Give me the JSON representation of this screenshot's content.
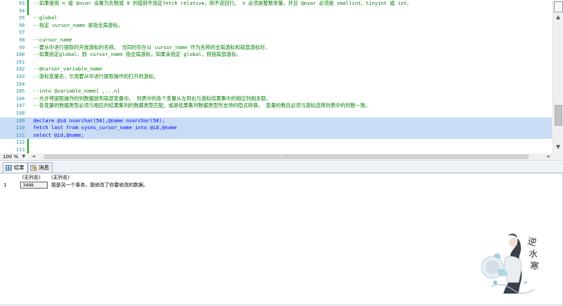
{
  "editor": {
    "lines": [
      {
        "num": "93",
        "text": "--如果使用 n 或 @nvar 设置为负数或 0 的值则不指定fetch relative，则不返回行。 n 必须是整数常量，并且 @nvar 必须是 smallint、tinyint 或 int。",
        "kind": "comment",
        "selected": false
      },
      {
        "num": "94",
        "text": "",
        "kind": "comment",
        "selected": false
      },
      {
        "num": "95",
        "text": "--global",
        "kind": "comment",
        "selected": false
      },
      {
        "num": "96",
        "text": "--指定 cursor_name 是指全局游标。",
        "kind": "comment",
        "selected": false
      },
      {
        "num": "97",
        "text": "",
        "kind": "comment",
        "selected": false
      },
      {
        "num": "98",
        "text": "--cursor_name",
        "kind": "comment",
        "selected": false
      },
      {
        "num": "99",
        "text": "--要从中进行提取的开放游标的名称。 当同时存在以 cursor_name 作为名称的全局游标和局部游标时，",
        "kind": "comment",
        "selected": false
      },
      {
        "num": "100",
        "text": "--如果指定global，则 cursor_name 指全局游标，如果未指定 global，则指局部游标。",
        "kind": "comment",
        "selected": false
      },
      {
        "num": "101",
        "text": "",
        "kind": "comment",
        "selected": false
      },
      {
        "num": "102",
        "text": "--@cursor_variable_name",
        "kind": "comment",
        "selected": false
      },
      {
        "num": "103",
        "text": "--游标变量名，引用要从中进行提取操作的打开的游标。",
        "kind": "comment",
        "selected": false
      },
      {
        "num": "104",
        "text": "",
        "kind": "comment",
        "selected": false
      },
      {
        "num": "105",
        "text": "--into @variable_name[ ,...n]",
        "kind": "comment",
        "selected": false
      },
      {
        "num": "106",
        "text": "--允许将提取操作的列数据放到局部变量中。 列表中的各个变量从左到右与游标结果集中的相应列相关联。",
        "kind": "comment",
        "selected": false
      },
      {
        "num": "107",
        "text": "--各变量的数据类型必须与相应的结果集列的数据类型匹配，或是结果集列数据类型所支持的隐式转换。 变量的数目必须与游标选择列表中的列数一致。",
        "kind": "comment",
        "selected": false
      },
      {
        "num": "108",
        "text": "",
        "kind": "comment",
        "selected": false
      },
      {
        "num": "109",
        "text": "declare @id nvarchar(50),@name nvarchar(50);",
        "kind": "code",
        "selected": true
      },
      {
        "num": "110",
        "text": "fetch last from sysns_cursor_name into @id,@name",
        "kind": "code",
        "selected": true
      },
      {
        "num": "111",
        "text": "select @id,@name;",
        "kind": "code",
        "selected": true
      },
      {
        "num": "112",
        "text": "",
        "kind": "code",
        "selected": false
      },
      {
        "num": "113",
        "text": "",
        "kind": "code",
        "selected": false
      }
    ]
  },
  "zoom": "100 %",
  "tabs": [
    {
      "label": "结果",
      "icon": "grid-icon",
      "active": true
    },
    {
      "label": "消息",
      "icon": "message-icon",
      "active": false
    }
  ],
  "results": {
    "columns": [
      "(无列名)",
      "(无列名)"
    ],
    "rows": [
      {
        "num": "1",
        "cells": [
          "3488",
          "我是另一个事务，我修改了你要修改的数据。"
        ]
      }
    ]
  },
  "colors": {
    "comment": "#008000",
    "keyword": "#0000ff",
    "line_number": "#2b91af",
    "selection": "#c8dcf5",
    "changed_marker": "#52b35a"
  }
}
